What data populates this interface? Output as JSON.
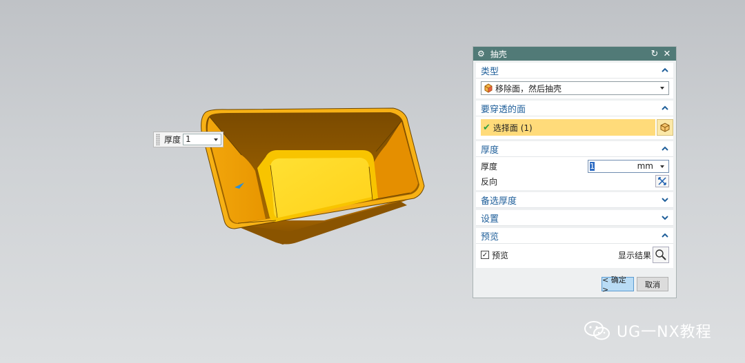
{
  "viewport": {
    "thickness_popup": {
      "label": "厚度",
      "value": "1"
    }
  },
  "dialog": {
    "title": "抽壳",
    "sections": {
      "type": {
        "header": "类型",
        "selected": "移除面，然后抽壳"
      },
      "pierce": {
        "header": "要穿透的面",
        "select_label": "选择面 (1)"
      },
      "thickness": {
        "header": "厚度",
        "thickness_label": "厚度",
        "value": "1",
        "unit": "mm",
        "reverse_label": "反向"
      },
      "alt_thickness": {
        "header": "备选厚度"
      },
      "settings": {
        "header": "设置"
      },
      "preview": {
        "header": "预览",
        "preview_label": "预览",
        "preview_checked": true,
        "show_result_label": "显示结果"
      }
    },
    "buttons": {
      "ok": "< 确定 >",
      "cancel": "取消"
    }
  },
  "watermark": {
    "text": "UG一NX教程"
  },
  "colors": {
    "titlebar": "#517a77",
    "section_header": "#1f5f9a",
    "selection_highlight": "#ffdb7a",
    "part_orange": "#f0a000"
  }
}
